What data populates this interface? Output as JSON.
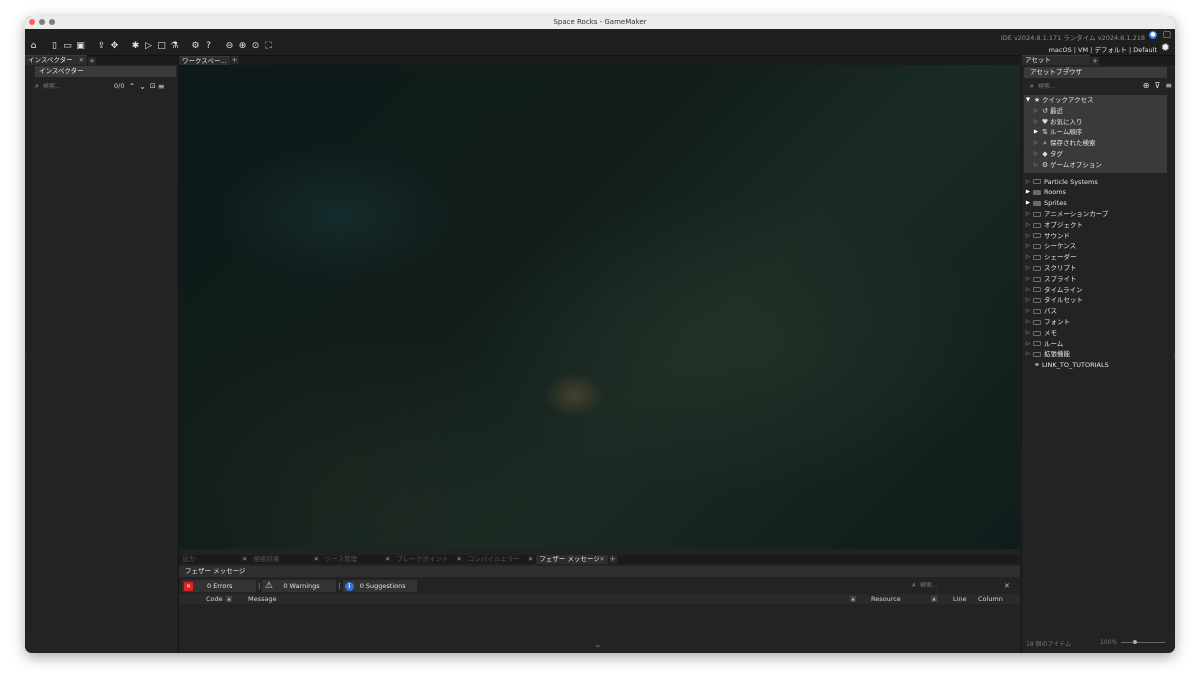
{
  "window": {
    "title": "Space Rocks - GameMaker"
  },
  "toolbar": {
    "version": "IDE v2024.8.1.171  ランタイム v2024.8.1.218",
    "target": "macOS | VM | デフォルト | Default",
    "icons": [
      "home-icon",
      "new-file-icon",
      "open-folder-icon",
      "save-icon",
      "export-icon",
      "clean-icon",
      "debug-icon",
      "run-icon",
      "stop-icon",
      "clean-build-icon",
      "settings-icon",
      "help-icon",
      "zoom-out-icon",
      "zoom-in-icon",
      "zoom-reset-icon",
      "workspace-fit-icon"
    ]
  },
  "inspector": {
    "tab_label": "インスペクター",
    "header": "インスペクター",
    "search_placeholder": "検索...",
    "counter": "0/0"
  },
  "workspace": {
    "tab_label": "ワークスペー..."
  },
  "output": {
    "tabs": [
      {
        "label": "出力"
      },
      {
        "label": "検索結果"
      },
      {
        "label": "ソース管理"
      },
      {
        "label": "ブレークポイント"
      },
      {
        "label": "コンパイルエラー"
      },
      {
        "label": "フェザー メッセージ"
      }
    ],
    "active_tab": "フェザー メッセージ",
    "header": "フェザー メッセージ",
    "errors": "0 Errors",
    "warnings": "0 Warnings",
    "suggestions": "0 Suggestions",
    "search_placeholder": "検索...",
    "columns": {
      "code": "Code",
      "message": "Message",
      "resource": "Resource",
      "line": "Line",
      "column": "Column"
    }
  },
  "assets": {
    "tab_label": "アセット",
    "header": "アセットブラウザ",
    "search_placeholder": "検索...",
    "quick_access": {
      "label": "クイックアクセス",
      "items": [
        {
          "label": "最近",
          "icon": "recent-icon"
        },
        {
          "label": "お気に入り",
          "icon": "heart-icon"
        },
        {
          "label": "ルーム順序",
          "icon": "room-order-icon"
        },
        {
          "label": "保存された検索",
          "icon": "saved-search-icon"
        },
        {
          "label": "タグ",
          "icon": "tag-icon"
        },
        {
          "label": "ゲームオプション",
          "icon": "gear-icon"
        }
      ]
    },
    "folders": [
      {
        "label": "Particle Systems",
        "expanded": false,
        "filled": false
      },
      {
        "label": "Rooms",
        "expanded": true,
        "filled": true
      },
      {
        "label": "Sprites",
        "expanded": true,
        "filled": true
      },
      {
        "label": "アニメーションカーブ",
        "expanded": false,
        "filled": false
      },
      {
        "label": "オブジェクト",
        "expanded": false,
        "filled": false
      },
      {
        "label": "サウンド",
        "expanded": false,
        "filled": false
      },
      {
        "label": "シーケンス",
        "expanded": false,
        "filled": false
      },
      {
        "label": "シェーダー",
        "expanded": false,
        "filled": false
      },
      {
        "label": "スクリプト",
        "expanded": false,
        "filled": false
      },
      {
        "label": "スプライト",
        "expanded": false,
        "filled": false
      },
      {
        "label": "タイムライン",
        "expanded": false,
        "filled": false
      },
      {
        "label": "タイルセット",
        "expanded": false,
        "filled": false
      },
      {
        "label": "パス",
        "expanded": false,
        "filled": false
      },
      {
        "label": "フォント",
        "expanded": false,
        "filled": false
      },
      {
        "label": "メモ",
        "expanded": false,
        "filled": false
      },
      {
        "label": "ルーム",
        "expanded": false,
        "filled": false
      },
      {
        "label": "拡張機能",
        "expanded": false,
        "filled": false
      }
    ],
    "link": "LINK_TO_TUTORIALS",
    "item_count": "18 個のアイテム",
    "zoom": "100%",
    "zoom_level": 0.3
  }
}
